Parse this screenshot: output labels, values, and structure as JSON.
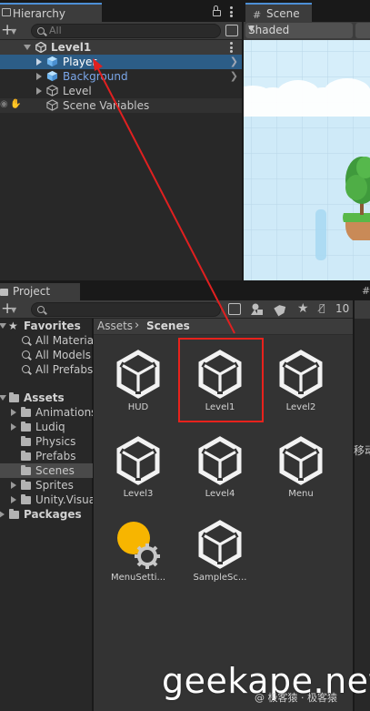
{
  "hierarchy": {
    "tab_label": "Hierarchy",
    "search_placeholder": "All",
    "scene_name": "Level1",
    "items": [
      {
        "label": "Player",
        "selected": true
      },
      {
        "label": "Background",
        "prefab": true
      },
      {
        "label": "Level"
      },
      {
        "label": "Scene Variables"
      }
    ]
  },
  "scene": {
    "tab_label": "Scene",
    "shading_mode": "Shaded"
  },
  "project": {
    "tab_label": "Project",
    "hidden_count": "10",
    "breadcrumb": [
      "Assets",
      "Scenes"
    ],
    "favorites": {
      "label": "Favorites",
      "items": [
        "All Materia",
        "All Models",
        "All Prefabs"
      ]
    },
    "assets": {
      "label": "Assets",
      "folders": [
        "Animations",
        "Ludiq",
        "Physics",
        "Prefabs",
        "Scenes",
        "Sprites",
        "Unity.Visua"
      ]
    },
    "packages_label": "Packages",
    "files": [
      {
        "name": "HUD",
        "icon": "unity-scene-icon"
      },
      {
        "name": "Level1",
        "icon": "unity-scene-icon",
        "highlighted": true
      },
      {
        "name": "Level2",
        "icon": "unity-scene-icon"
      },
      {
        "name": "Level3",
        "icon": "unity-scene-icon"
      },
      {
        "name": "Level4",
        "icon": "unity-scene-icon"
      },
      {
        "name": "Menu",
        "icon": "unity-scene-icon"
      },
      {
        "name": "MenuSetti...",
        "icon": "lighting-settings-icon"
      },
      {
        "name": "SampleSc...",
        "icon": "unity-scene-icon"
      }
    ]
  },
  "right_strip_text": "移动",
  "watermark": {
    "main": "geekape.net",
    "sub": "@ 极客猿 · 极客猿"
  },
  "colors": {
    "selection": "#2c5d87",
    "tab_accent": "#4d8fd6",
    "prefab_blue": "#7ba6e8",
    "highlight_box": "#e8221c",
    "annotation_arrow": "#e02020",
    "sky": "#d3ecf9"
  }
}
